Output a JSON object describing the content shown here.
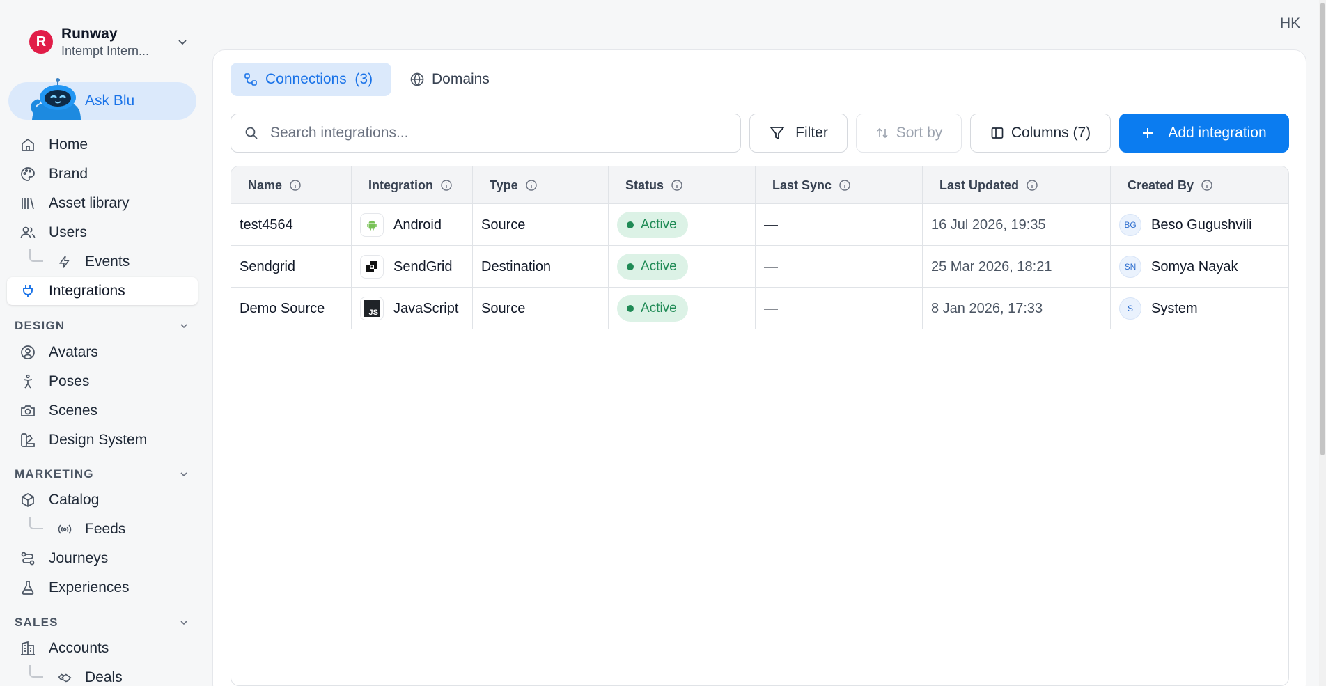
{
  "org": {
    "initial": "R",
    "name": "Runway",
    "subtitle": "Intempt Intern..."
  },
  "ask_blu": {
    "label": "Ask Blu"
  },
  "user": {
    "initials": "HK"
  },
  "sidebar": {
    "items": [
      {
        "label": "Home",
        "icon": "home-icon"
      },
      {
        "label": "Brand",
        "icon": "palette-icon"
      },
      {
        "label": "Asset library",
        "icon": "library-icon"
      },
      {
        "label": "Users",
        "icon": "users-icon"
      },
      {
        "label": "Events",
        "icon": "bolt-icon"
      },
      {
        "label": "Integrations",
        "icon": "plug-icon"
      }
    ],
    "design": {
      "title": "DESIGN",
      "items": [
        {
          "label": "Avatars",
          "icon": "user-circle-icon"
        },
        {
          "label": "Poses",
          "icon": "person-icon"
        },
        {
          "label": "Scenes",
          "icon": "camera-icon"
        },
        {
          "label": "Design System",
          "icon": "swatch-icon"
        }
      ]
    },
    "marketing": {
      "title": "MARKETING",
      "items": [
        {
          "label": "Catalog",
          "icon": "box-icon"
        },
        {
          "label": "Feeds",
          "icon": "broadcast-icon"
        },
        {
          "label": "Journeys",
          "icon": "route-icon"
        },
        {
          "label": "Experiences",
          "icon": "flask-icon"
        }
      ]
    },
    "sales": {
      "title": "SALES",
      "items": [
        {
          "label": "Accounts",
          "icon": "building-icon"
        },
        {
          "label": "Deals",
          "icon": "handshake-icon"
        }
      ]
    }
  },
  "tabs": {
    "connections": "Connections  (3)",
    "domains": "Domains"
  },
  "toolbar": {
    "search_placeholder": "Search integrations...",
    "filter": "Filter",
    "sort": "Sort by",
    "columns": "Columns (7)",
    "add": "Add integration"
  },
  "table": {
    "headers": [
      "Name",
      "Integration",
      "Type",
      "Status",
      "Last Sync",
      "Last Updated",
      "Created By"
    ],
    "rows": [
      {
        "name": "test4564",
        "integration": "Android",
        "integration_icon": "android-icon",
        "type": "Source",
        "status": "Active",
        "last_sync": "—",
        "last_updated": "16 Jul 2026, 19:35",
        "creator_initials": "BG",
        "creator": "Beso Gugushvili"
      },
      {
        "name": "Sendgrid",
        "integration": "SendGrid",
        "integration_icon": "sendgrid-icon",
        "type": "Destination",
        "status": "Active",
        "last_sync": "—",
        "last_updated": "25 Mar 2026, 18:21",
        "creator_initials": "SN",
        "creator": "Somya Nayak"
      },
      {
        "name": "Demo Source",
        "integration": "JavaScript",
        "integration_icon": "javascript-icon",
        "type": "Source",
        "status": "Active",
        "last_sync": "—",
        "last_updated": "8 Jan 2026, 17:33",
        "creator_initials": "S",
        "creator": "System"
      }
    ]
  },
  "colors": {
    "accent": "#0b7cf0",
    "org_avatar": "#e11d48",
    "status_active_bg": "#dcf2e6",
    "status_active_fg": "#1f8a55"
  }
}
